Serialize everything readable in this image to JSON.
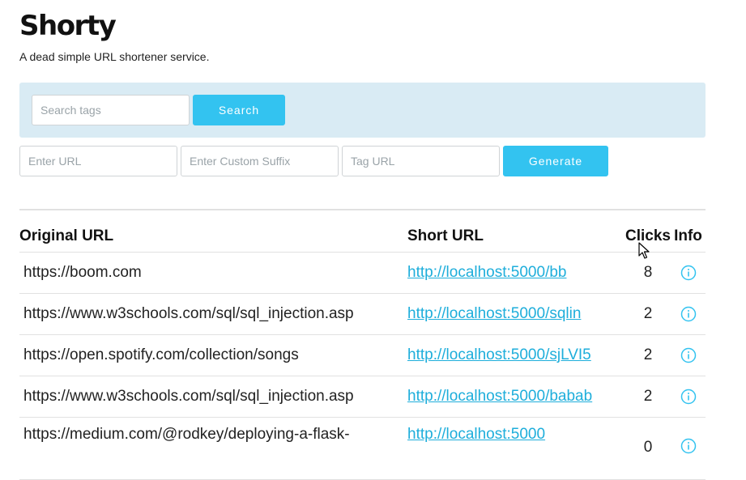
{
  "header": {
    "title": "Shorty",
    "subtitle": "A dead simple URL shortener service."
  },
  "search": {
    "placeholder": "Search tags",
    "button_label": "Search"
  },
  "generate_form": {
    "url_placeholder": "Enter URL",
    "suffix_placeholder": "Enter Custom Suffix",
    "tag_placeholder": "Tag URL",
    "button_label": "Generate"
  },
  "table": {
    "columns": [
      "Original URL",
      "Short URL",
      "Clicks",
      "Info"
    ],
    "rows": [
      {
        "original": "https://boom.com",
        "short": "http://localhost:5000/bb",
        "clicks": "8"
      },
      {
        "original": "https://www.w3schools.com/sql/sql_injection.asp",
        "short": "http://localhost:5000/sqlin",
        "clicks": "2"
      },
      {
        "original": "https://open.spotify.com/collection/songs",
        "short": "http://localhost:5000/sjLVI5",
        "clicks": "2"
      },
      {
        "original": "https://www.w3schools.com/sql/sql_injection.asp",
        "short": "http://localhost:5000/babab",
        "clicks": "2"
      },
      {
        "original": "https://medium.com/@rodkey/deploying-a-flask-",
        "short": "http://localhost:5000",
        "clicks": "0"
      }
    ]
  },
  "colors": {
    "accent": "#33c3f0",
    "link": "#1eaedb",
    "panel_bg": "#d9ebf4"
  },
  "icons": {
    "info": "info-circle-icon",
    "cursor": "mouse-pointer-icon"
  }
}
